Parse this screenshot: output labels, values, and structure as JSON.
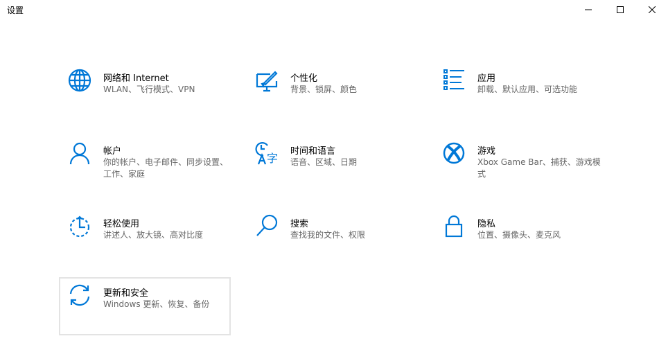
{
  "window": {
    "title": "设置"
  },
  "accent": "#0078d7",
  "tiles": [
    {
      "title": "网络和 Internet",
      "desc": "WLAN、飞行模式、VPN",
      "icon": "globe-icon"
    },
    {
      "title": "个性化",
      "desc": "背景、锁屏、颜色",
      "icon": "personalization-icon"
    },
    {
      "title": "应用",
      "desc": "卸载、默认应用、可选功能",
      "icon": "apps-list-icon"
    },
    {
      "title": "帐户",
      "desc": "你的帐户、电子邮件、同步设置、工作、家庭",
      "icon": "person-icon"
    },
    {
      "title": "时间和语言",
      "desc": "语音、区域、日期",
      "icon": "time-language-icon"
    },
    {
      "title": "游戏",
      "desc": "Xbox Game Bar、捕获、游戏模式",
      "icon": "xbox-icon"
    },
    {
      "title": "轻松使用",
      "desc": "讲述人、放大镜、高对比度",
      "icon": "ease-of-access-icon"
    },
    {
      "title": "搜索",
      "desc": "查找我的文件、权限",
      "icon": "search-icon"
    },
    {
      "title": "隐私",
      "desc": "位置、摄像头、麦克风",
      "icon": "lock-icon"
    },
    {
      "title": "更新和安全",
      "desc": "Windows 更新、恢复、备份",
      "icon": "sync-icon"
    }
  ]
}
